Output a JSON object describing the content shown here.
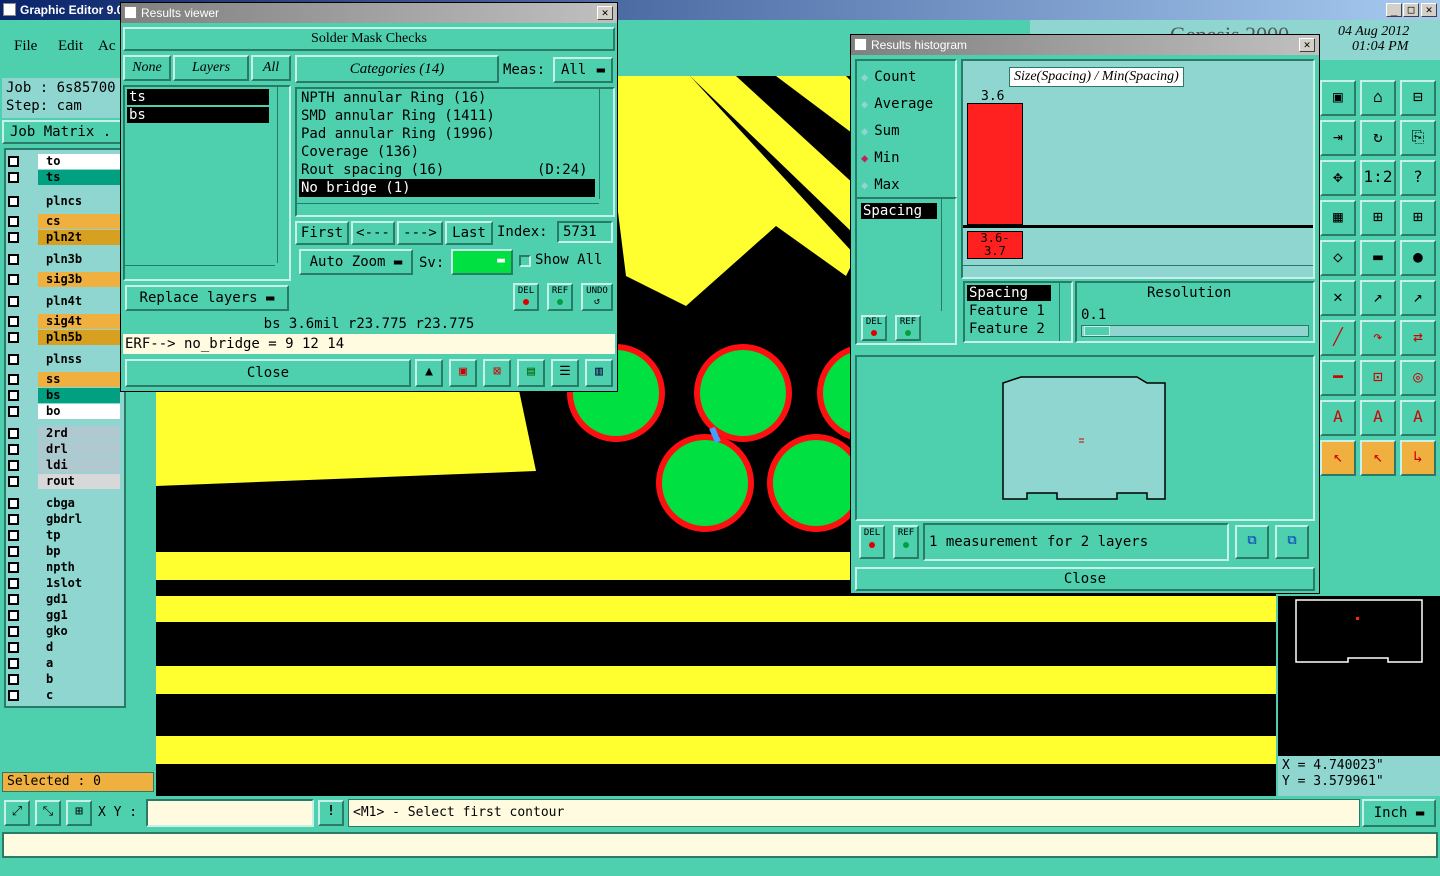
{
  "app": {
    "title": "Graphic Editor 9.0",
    "menu": [
      "File",
      "Edit",
      "Ac"
    ],
    "job_label": "Job : 6s85700",
    "step_label": "Step: cam",
    "job_matrix": "Job Matrix .",
    "date": "04 Aug 2012",
    "time": "01:04 PM",
    "brand_partial": "Genesis 2000"
  },
  "layers": [
    {
      "name": "to",
      "color": "#ffffff"
    },
    {
      "name": "ts",
      "color": "#00a080"
    },
    {
      "name": "plncs",
      "color": "#8fd6d0"
    },
    {
      "name": "cs",
      "color": "#f0b040"
    },
    {
      "name": "pln2t",
      "color": "#d8a020"
    },
    {
      "name": "pln3b",
      "color": "#8fd6d0"
    },
    {
      "name": "sig3b",
      "color": "#f0b040"
    },
    {
      "name": "pln4t",
      "color": "#8fd6d0"
    },
    {
      "name": "sig4t",
      "color": "#f0b040"
    },
    {
      "name": "pln5b",
      "color": "#d8a020"
    },
    {
      "name": "plnss",
      "color": "#8fd6d0"
    },
    {
      "name": "ss",
      "color": "#f0b040"
    },
    {
      "name": "bs",
      "color": "#00a080"
    },
    {
      "name": "bo",
      "color": "#ffffff"
    },
    {
      "name": "2rd",
      "color": "#b0c8d0"
    },
    {
      "name": "drl",
      "color": "#b0c8d0"
    },
    {
      "name": "ldi",
      "color": "#b0c8d0"
    },
    {
      "name": "rout",
      "color": "#d8d8d8"
    },
    {
      "name": "cbga",
      "color": "#8fd6d0"
    },
    {
      "name": "gbdrl",
      "color": "#8fd6d0"
    },
    {
      "name": "tp",
      "color": "#8fd6d0"
    },
    {
      "name": "bp",
      "color": "#8fd6d0"
    },
    {
      "name": "npth",
      "color": "#8fd6d0"
    },
    {
      "name": "1slot",
      "color": "#8fd6d0"
    },
    {
      "name": "gd1",
      "color": "#8fd6d0"
    },
    {
      "name": "gg1",
      "color": "#8fd6d0"
    },
    {
      "name": "gko",
      "color": "#8fd6d0"
    },
    {
      "name": "d",
      "color": "#8fd6d0"
    },
    {
      "name": "a",
      "color": "#8fd6d0"
    },
    {
      "name": "b",
      "color": "#8fd6d0"
    },
    {
      "name": "c",
      "color": "#8fd6d0"
    }
  ],
  "selected_label": "Selected : 0",
  "results_viewer": {
    "title": "Results viewer",
    "heading": "Solder Mask Checks",
    "none": "None",
    "layers": "Layers",
    "all": "All",
    "categories": "Categories (14)",
    "meas_label": "Meas:",
    "meas_value": "All",
    "layer_list": [
      "ts",
      "bs"
    ],
    "category_list": [
      "NPTH annular Ring (16)",
      "SMD annular Ring (1411)",
      "Pad annular Ring (1996)",
      "Coverage (136)",
      "Rout spacing (16)           (D:24)",
      "No bridge (1)"
    ],
    "first": "First",
    "prev": "<---",
    "next": "--->",
    "last": "Last",
    "index_label": "Index:",
    "index_value": "5731",
    "auto_zoom": "Auto Zoom",
    "sv_label": "Sv:",
    "show_all": "Show All",
    "replace_layers": "Replace layers",
    "del": "DEL",
    "ref": "REF",
    "undo": "UNDO",
    "status": "bs 3.6mil   r23.775   r23.775",
    "erf": "ERF--> no_bridge = 9 12 14",
    "close": "Close"
  },
  "histogram": {
    "title": "Results histogram",
    "options": [
      "Count",
      "Average",
      "Sum",
      "Min",
      "Max"
    ],
    "selected_option": "Min",
    "chart_title": "Size(Spacing) / Min(Spacing)",
    "bar_value": "3.6",
    "bin_label_1": "3.6-",
    "bin_label_2": "3.7",
    "list_item": "Spacing",
    "attrs": [
      "Spacing",
      "Feature 1",
      "Feature 2"
    ],
    "resolution_label": "Resolution",
    "resolution_value": "0.1",
    "status": "1 measurement for 2 layers",
    "close": "Close",
    "del": "DEL",
    "ref": "REF"
  },
  "coords": {
    "x": "X = 4.740023\"",
    "y": "Y = 3.579961\""
  },
  "bottom": {
    "xy_label": "X Y :",
    "hint": "<M1> - Select first contour",
    "units": "Inch"
  },
  "colors": {
    "teal": "#4ecfae",
    "pcb_yellow": "#ffff30",
    "pcb_black": "#000000",
    "pad_green": "#00e040",
    "pad_red": "#ff1010"
  }
}
